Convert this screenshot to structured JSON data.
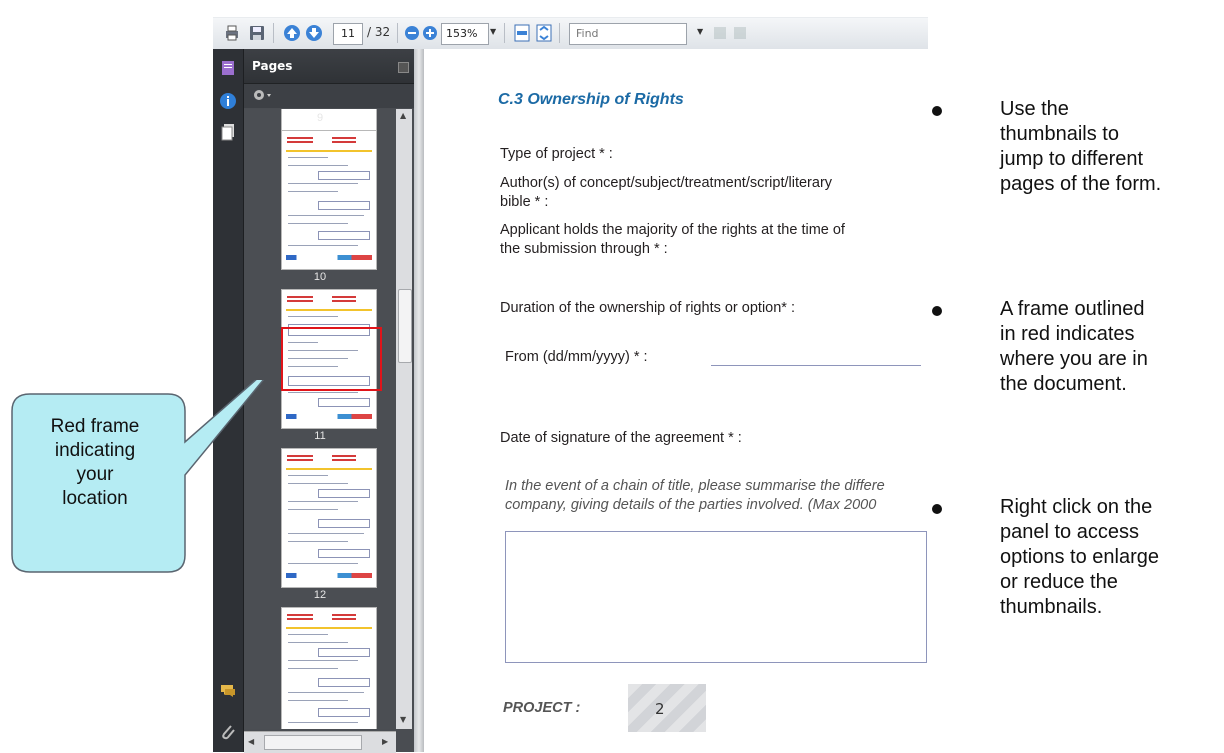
{
  "toolbar": {
    "page_current": "11",
    "page_total": "/ 32",
    "zoom": "153%",
    "find_placeholder": "Find"
  },
  "pages_panel": {
    "title": "Pages",
    "thumbnails": [
      "9",
      "10",
      "11",
      "12"
    ]
  },
  "document": {
    "section_title": "C.3 Ownership of Rights",
    "type_of_project": "Type of project * :",
    "author_line1": "Author(s) of concept/subject/treatment/script/literary",
    "author_line2": "bible * :",
    "applicant_line1": "Applicant holds the majority of the rights at the time of",
    "applicant_line2": "the submission through * :",
    "duration": "Duration of the ownership of rights or option* :",
    "from": "From (dd/mm/yyyy) * :",
    "date_signature": "Date of signature of the agreement * :",
    "chain_line1": "In the event of a chain of title, please summarise the differe",
    "chain_line2": "company, giving details of the parties involved. (Max 2000",
    "project_label": "PROJECT :",
    "project_value": "2"
  },
  "callout": {
    "line1": "Red frame",
    "line2": "indicating",
    "line3": "your",
    "line4": "location"
  },
  "bullets": [
    [
      "Use the",
      "thumbnails to",
      "jump to different",
      "pages of the form."
    ],
    [
      "A frame outlined",
      "in red indicates",
      "where you are in",
      "the document."
    ],
    [
      "Right click on the",
      "panel to access",
      "options to enlarge",
      "or reduce the",
      "thumbnails."
    ]
  ],
  "colors": {
    "title_blue": "#1b6aa5",
    "frame_red": "#e0141a",
    "callout_fill": "#b5ecf3"
  }
}
